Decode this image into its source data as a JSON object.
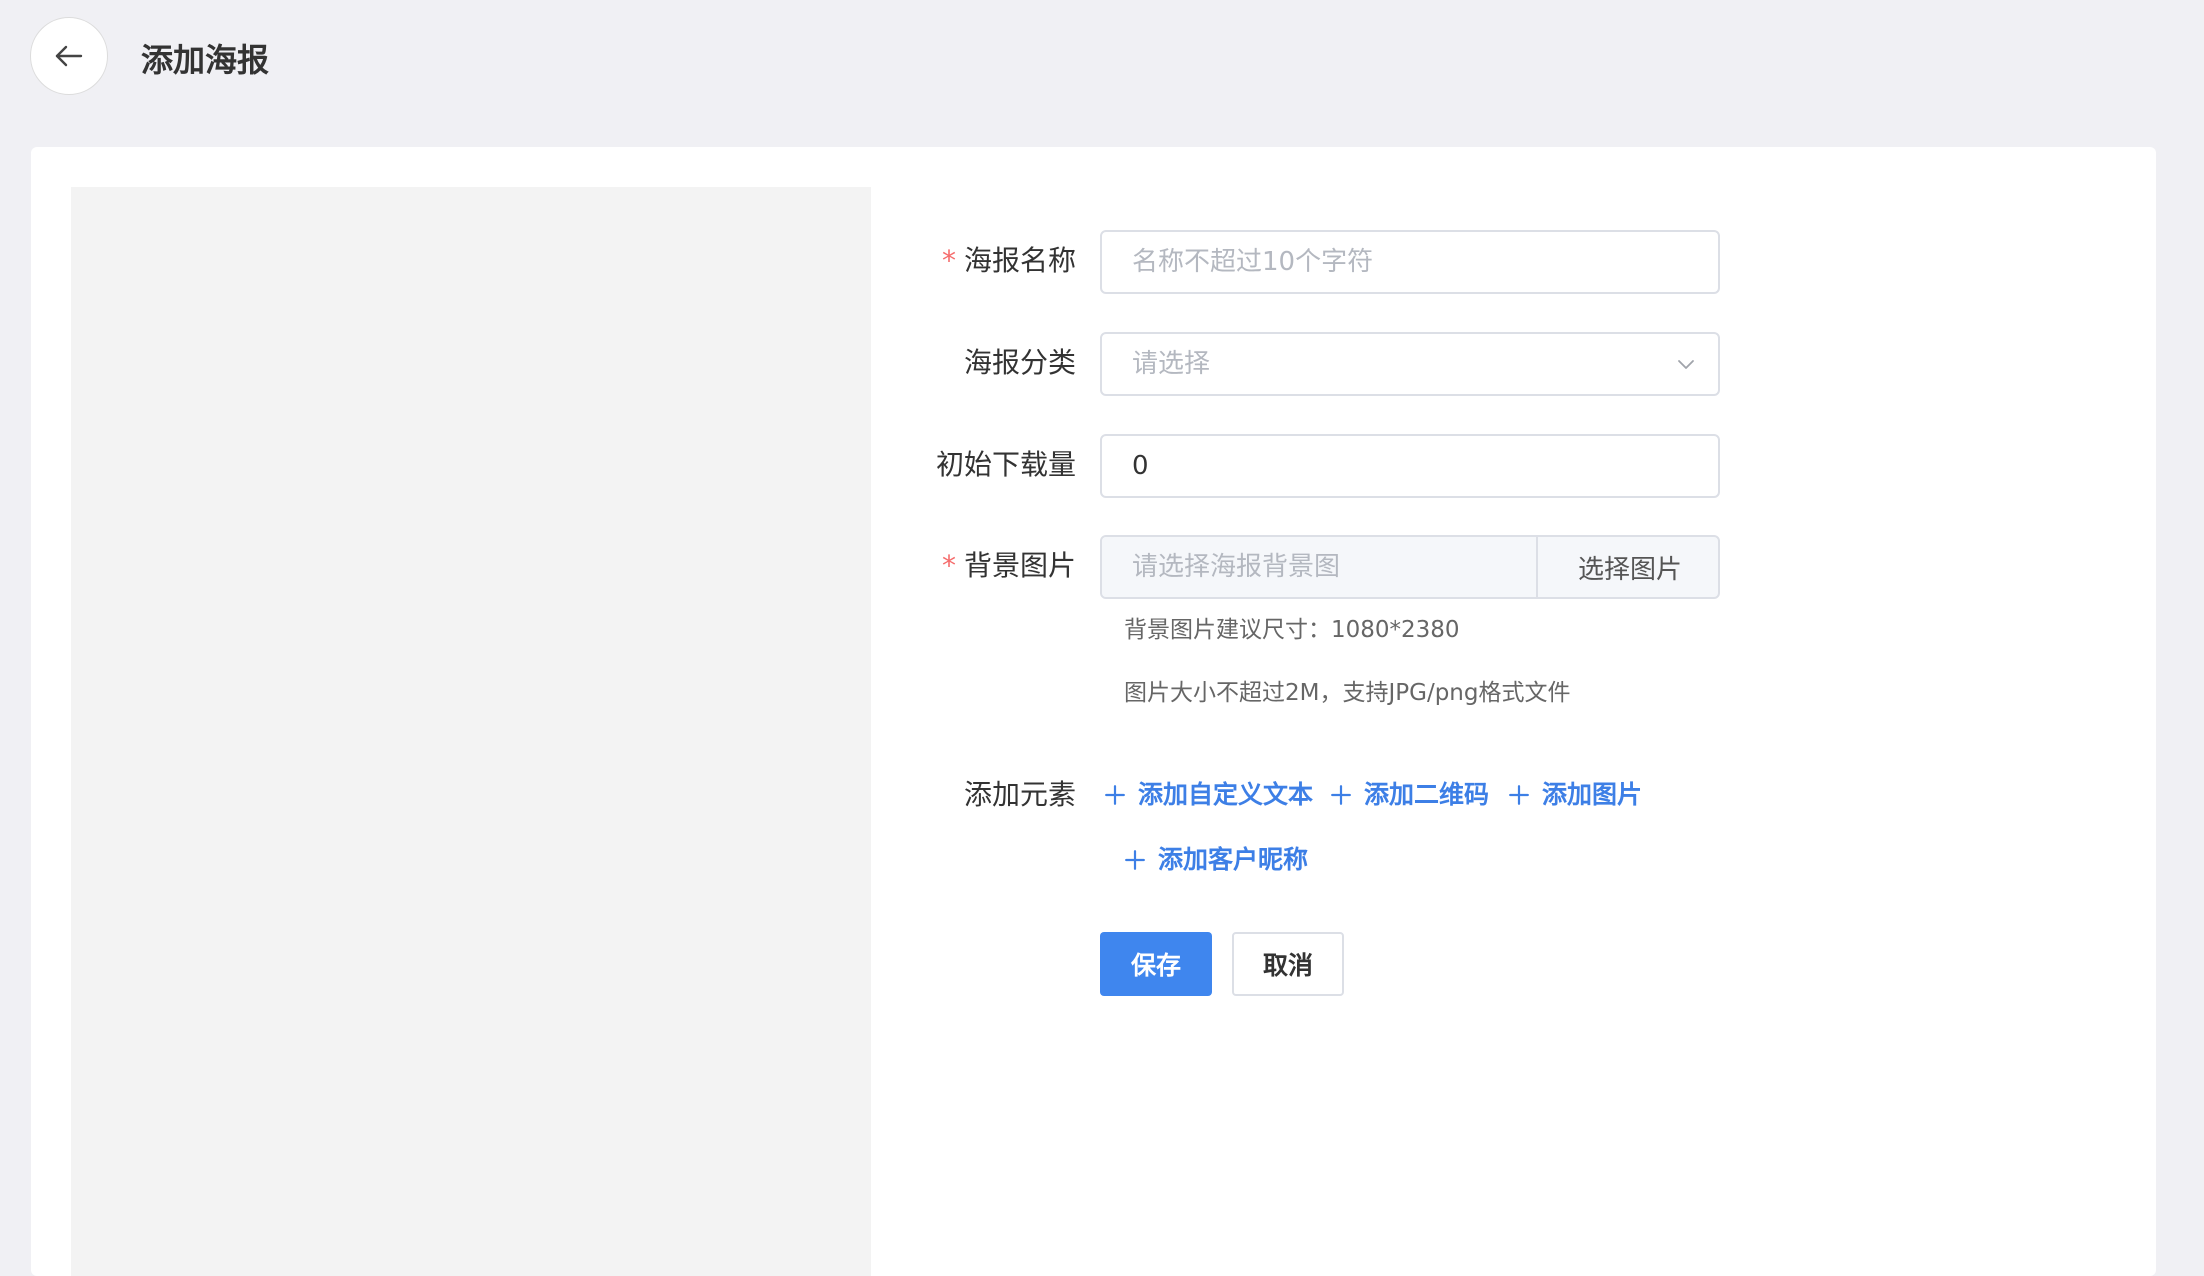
{
  "header": {
    "back_icon": "arrow-left-icon",
    "title": "添加海报"
  },
  "form": {
    "name": {
      "label": "海报名称",
      "required": true,
      "placeholder": "名称不超过10个字符",
      "value": ""
    },
    "category": {
      "label": "海报分类",
      "placeholder": "请选择",
      "icon": "chevron-down-icon"
    },
    "downloads": {
      "label": "初始下载量",
      "value": "0"
    },
    "background": {
      "label": "背景图片",
      "required": true,
      "placeholder": "请选择海报背景图",
      "button_label": "选择图片",
      "hint_size": "背景图片建议尺寸：1080*2380",
      "hint_format": "图片大小不超过2M，支持JPG/png格式文件"
    },
    "elements": {
      "label": "添加元素",
      "items": [
        "添加自定义文本",
        "添加二维码",
        "添加图片",
        "添加客户昵称"
      ]
    },
    "actions": {
      "save_label": "保存",
      "cancel_label": "取消"
    }
  },
  "colors": {
    "primary": "#3f86ee",
    "link": "#3d7fe6",
    "required": "#f56c6c",
    "page_bg": "#f0f0f4",
    "preview_bg": "#f3f3f3"
  }
}
